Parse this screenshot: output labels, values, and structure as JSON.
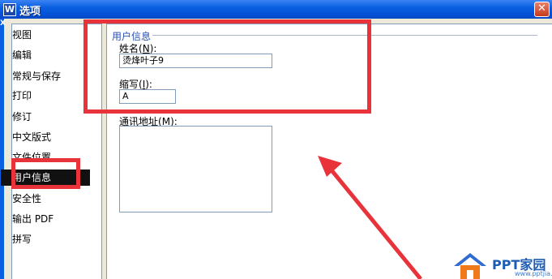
{
  "window": {
    "title": "选项",
    "app_icon_letter": "W",
    "close_glyph": "✕",
    "left_strip_glyph": "X"
  },
  "sidebar": {
    "items": [
      {
        "label": "视图"
      },
      {
        "label": "编辑"
      },
      {
        "label": "常规与保存"
      },
      {
        "label": "打印"
      },
      {
        "label": "修订"
      },
      {
        "label": "中文版式"
      },
      {
        "label": "文件位置"
      },
      {
        "label": "用户信息",
        "selected": true
      },
      {
        "label": "安全性"
      },
      {
        "label": "输出 PDF"
      },
      {
        "label": "拼写"
      }
    ]
  },
  "user_info": {
    "group_title": "用户信息",
    "name_label": "姓名",
    "name_hotkey": "N",
    "name_value": "烫烽叶子9",
    "initials_label": "缩写",
    "initials_hotkey": "I",
    "initials_value": "A",
    "address_label": "通讯地址",
    "address_hotkey": "M"
  },
  "watermark": {
    "brand": "PPT家园",
    "url": "www.pptjia.com"
  },
  "colors": {
    "annotation_red": "#e8333a",
    "titlebar_blue": "#0a5fe0",
    "group_title_blue": "#2b4fb0"
  }
}
